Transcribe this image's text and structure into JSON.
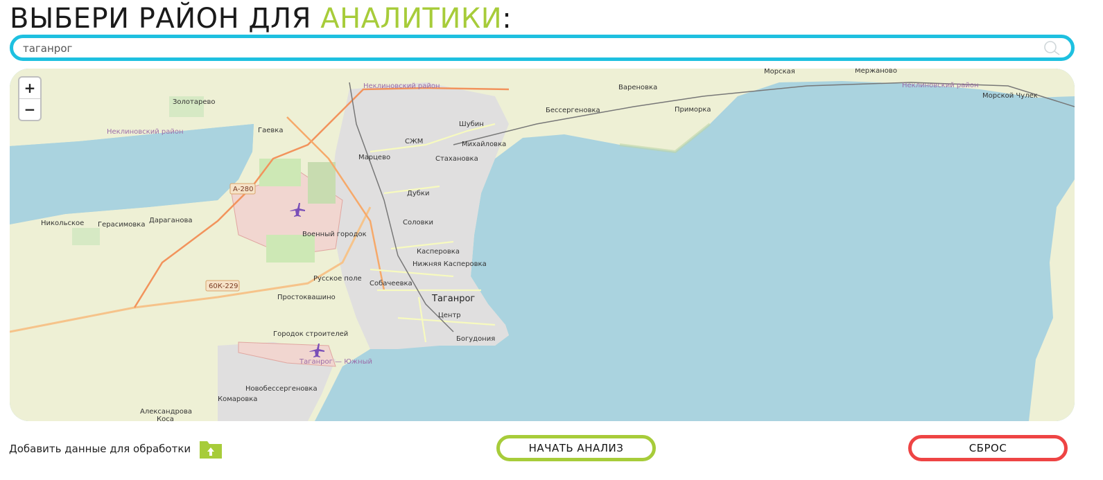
{
  "header": {
    "title_main": "ВЫБЕРИ РАЙОН ДЛЯ ",
    "title_accent": "АНАЛИТИКИ",
    "title_suffix": ":"
  },
  "search": {
    "value": "таганрог",
    "placeholder": "таганрог"
  },
  "map": {
    "zoom_in": "+",
    "zoom_out": "−",
    "places": [
      "Золотарево",
      "Гаевка",
      "Марцево",
      "СЖМ",
      "Шубин",
      "Михайловка",
      "Стахановка",
      "Вареновка",
      "Бессергеновка",
      "Приморка",
      "Морская",
      "Мержаново",
      "Морской Чулек",
      "Дубки",
      "Соловки",
      "Военный городок",
      "Касперовка",
      "Нижняя Касперовка",
      "Русское поле",
      "Собачеевка",
      "Простоквашино",
      "Таганрог",
      "Центр",
      "Городок строителей",
      "Богудония",
      "Новобессергеновка",
      "Комаровка",
      "Александрова",
      "Коса",
      "Никольское",
      "Герасимовка",
      "Дараганова"
    ],
    "district_labels": [
      "Неклиновский район",
      "Неклиновский район",
      "Неклиновский район"
    ],
    "airport_label": "Таганрог — Южный",
    "road_shields": [
      "А-280",
      "60К-229"
    ],
    "colors": {
      "water": "#aad3df",
      "land": "#f2efe9",
      "farmland": "#eef0d5",
      "urban": "#e0dfdf",
      "road": "#f7fabf",
      "trunk": "#f2935c"
    }
  },
  "footer": {
    "add_data_label": "Добавить данные для обработки",
    "start_label": "НАЧАТЬ АНАЛИЗ",
    "reset_label": "СБРОС"
  },
  "colors": {
    "accent_green": "#a7cc3a",
    "accent_cyan": "#1ec0e0",
    "accent_red": "#ee4444"
  },
  "icons": {
    "search": "search-icon",
    "folder": "folder-upload-icon",
    "airport": "airport-icon"
  }
}
